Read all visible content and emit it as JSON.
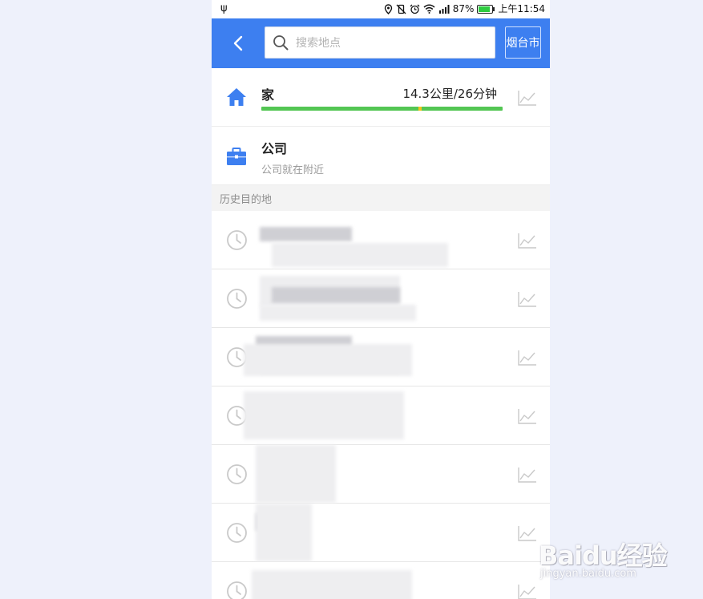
{
  "status_bar": {
    "usb_icon": "usb-icon",
    "icons": [
      "location-icon",
      "vibrate-icon",
      "alarm-icon",
      "wifi-icon",
      "signal-icon"
    ],
    "battery_percent": "87%",
    "battery_level": 0.87,
    "time": "上午11:54"
  },
  "header": {
    "back_icon": "chevron-left-icon",
    "search": {
      "placeholder": "搜索地点",
      "value": ""
    },
    "city": "烟台市",
    "color": "#3d7ff0"
  },
  "home": {
    "label": "家",
    "eta": "14.3公里/26分钟",
    "icon": "home-icon",
    "traffic_color": "#53c653",
    "traffic_slow_color": "#f5c31c",
    "traffic_slow_position": 0.65
  },
  "company": {
    "label": "公司",
    "subtitle": "公司就在附近",
    "icon": "briefcase-icon"
  },
  "history": {
    "title": "历史目的地",
    "items": [
      {
        "icon": "clock-icon"
      },
      {
        "icon": "clock-icon"
      },
      {
        "icon": "clock-icon"
      },
      {
        "icon": "clock-icon"
      },
      {
        "icon": "clock-icon"
      },
      {
        "icon": "clock-icon"
      },
      {
        "icon": "clock-icon"
      }
    ]
  },
  "watermark": {
    "logo": "Baidu经验",
    "url": "jingyan.baidu.com"
  }
}
